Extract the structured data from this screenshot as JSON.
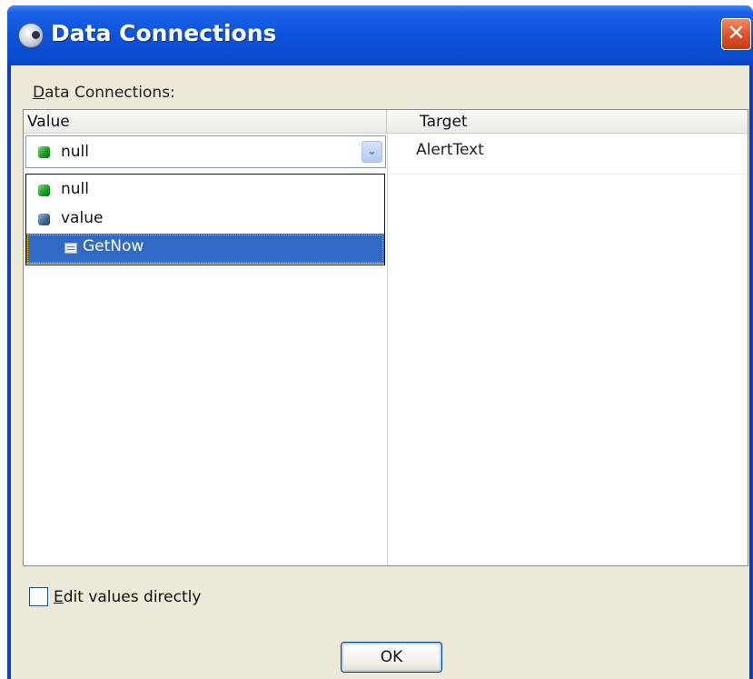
{
  "window": {
    "title": "Data Connections",
    "close_glyph": "✕",
    "titlebar_color": "#0a47c8"
  },
  "group": {
    "label_first": "D",
    "label_rest": "ata Connections:"
  },
  "grid": {
    "columns": [
      "Value",
      "Target"
    ],
    "combo_value": "null",
    "combo_arrow": "⌄",
    "target_value": "AlertText"
  },
  "dropdown": {
    "items": [
      {
        "label": "null",
        "icon": "green-cube-icon"
      },
      {
        "label": "value",
        "icon": "blue-cube-icon"
      },
      {
        "label": "GetNow",
        "icon": "method-icon",
        "selected": true
      }
    ]
  },
  "options": {
    "edit_first": "E",
    "edit_rest": "dit values directly",
    "edit_checked": false
  },
  "buttons": {
    "ok": "OK"
  }
}
